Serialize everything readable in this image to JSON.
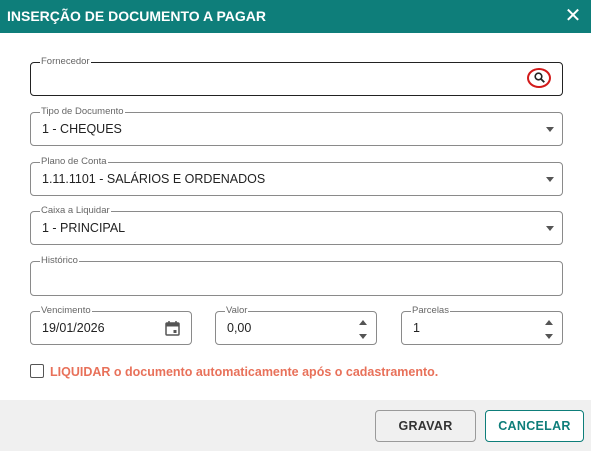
{
  "dialog": {
    "title": "INSERÇÃO DE DOCUMENTO A PAGAR",
    "close_icon": "close-icon"
  },
  "colors": {
    "header": "#0e7e7a",
    "accent_text": "#e8715a",
    "highlight_ring": "#d21a1a"
  },
  "fields": {
    "fornecedor": {
      "label": "Fornecedor",
      "value": ""
    },
    "tipo_documento": {
      "label": "Tipo de Documento",
      "value": "1 - CHEQUES"
    },
    "plano_conta": {
      "label": "Plano de Conta",
      "value": "1.11.1101 - SALÁRIOS E ORDENADOS"
    },
    "caixa_liquidar": {
      "label": "Caixa a Liquidar",
      "value": "1 - PRINCIPAL"
    },
    "historico": {
      "label": "Histórico",
      "value": ""
    },
    "vencimento": {
      "label": "Vencimento",
      "value": "19/01/2026"
    },
    "valor": {
      "label": "Valor",
      "value": "0,00"
    },
    "parcelas": {
      "label": "Parcelas",
      "value": "1"
    }
  },
  "liquidar_checkbox": {
    "label": "LIQUIDAR o documento automaticamente após o cadastramento.",
    "checked": false
  },
  "buttons": {
    "gravar": "GRAVAR",
    "cancelar": "CANCELAR"
  }
}
